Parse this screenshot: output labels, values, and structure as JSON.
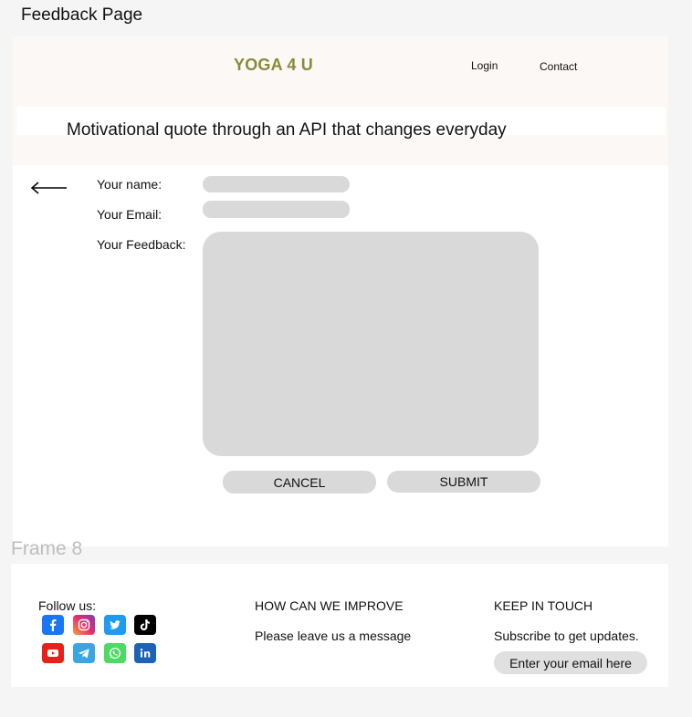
{
  "page_label": "Feedback Page",
  "frame_label": "Frame 8",
  "header": {
    "brand": "YOGA 4 U",
    "nav": {
      "login": "Login",
      "contact": "Contact"
    }
  },
  "quote": "Motivational quote through an API that changes everyday",
  "form": {
    "name_label": "Your name:",
    "email_label": "Your Email:",
    "feedback_label": "Your Feedback:",
    "cancel_label": "CANCEL",
    "submit_label": "SUBMIT"
  },
  "footer": {
    "follow_label": "Follow us:",
    "social_icons": [
      "facebook-icon",
      "instagram-icon",
      "twitter-icon",
      "tiktok-icon",
      "youtube-icon",
      "telegram-icon",
      "whatsapp-icon",
      "linkedin-icon"
    ],
    "improve_title": "HOW CAN WE IMPROVE",
    "improve_text": "Please leave us a message",
    "touch_title": "KEEP IN TOUCH",
    "touch_text": "Subscribe to get updates.",
    "email_placeholder": "Enter your email here"
  },
  "colors": {
    "brand": "#8a8a3a",
    "header_bg": "#fcf8f6",
    "field_bg": "#d9d9d9",
    "facebook": "#1877f2",
    "instagram": "#c13584",
    "twitter": "#1d9bf0",
    "tiktok": "#000000",
    "youtube": "#e62117",
    "telegram": "#3aa5e0",
    "whatsapp": "#4cd964",
    "linkedin": "#1c63b7"
  }
}
